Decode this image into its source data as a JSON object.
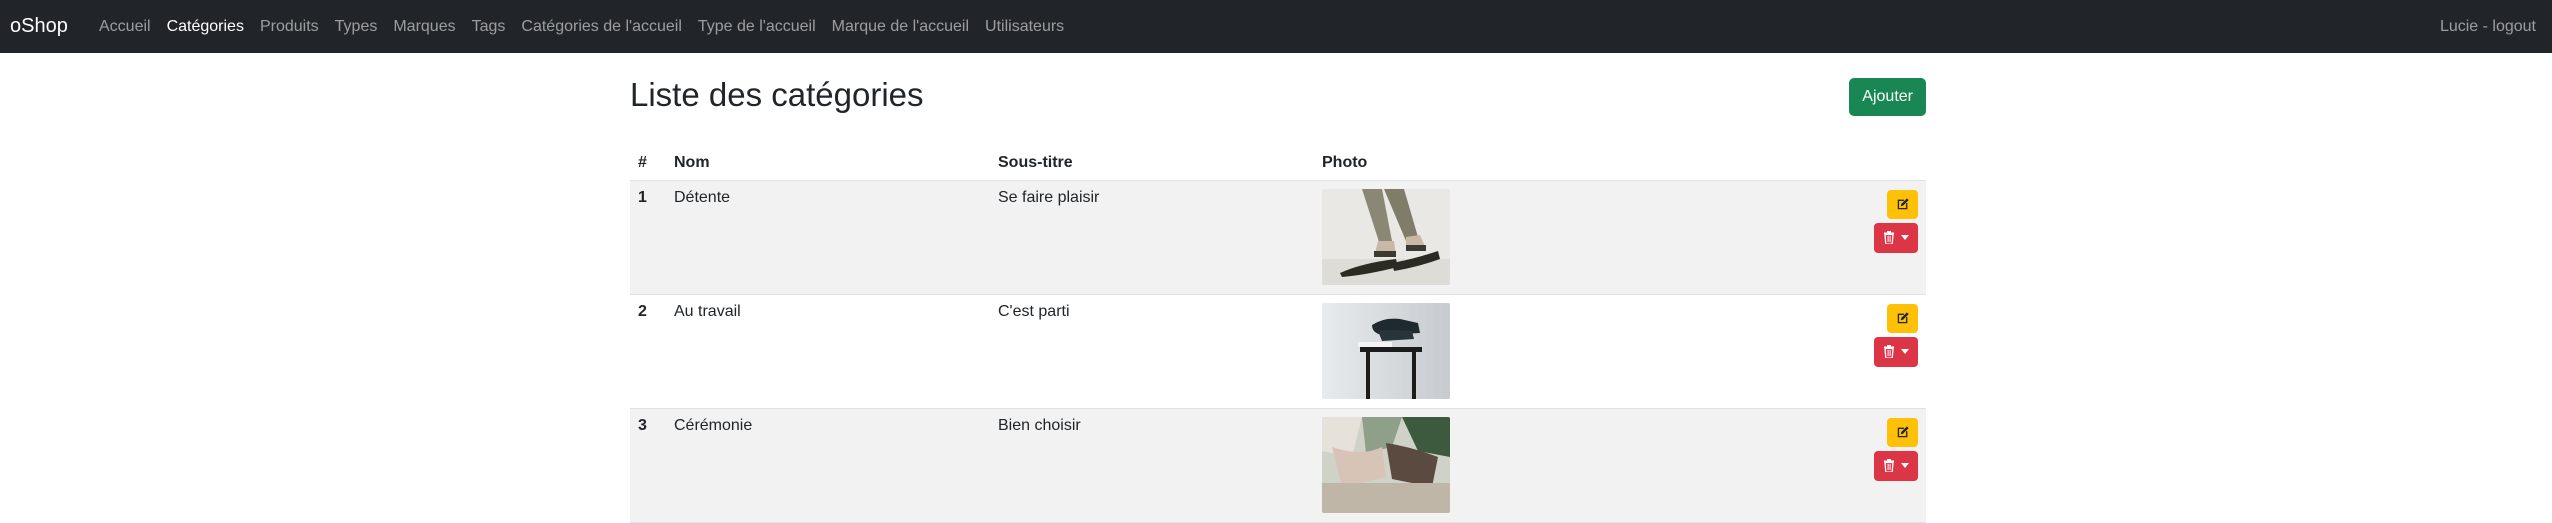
{
  "navbar": {
    "brand": "oShop",
    "links": [
      {
        "label": "Accueil",
        "active": false
      },
      {
        "label": "Catégories",
        "active": true
      },
      {
        "label": "Produits",
        "active": false
      },
      {
        "label": "Types",
        "active": false
      },
      {
        "label": "Marques",
        "active": false
      },
      {
        "label": "Tags",
        "active": false
      },
      {
        "label": "Catégories de l'accueil",
        "active": false
      },
      {
        "label": "Type de l'accueil",
        "active": false
      },
      {
        "label": "Marque de l'accueil",
        "active": false
      },
      {
        "label": "Utilisateurs",
        "active": false
      }
    ],
    "user": "Lucie - logout"
  },
  "page": {
    "title": "Liste des catégories",
    "add_button": "Ajouter"
  },
  "table": {
    "headers": [
      "#",
      "Nom",
      "Sous-titre",
      "Photo"
    ],
    "rows": [
      {
        "id": "1",
        "name": "Détente",
        "subtitle": "Se faire plaisir",
        "photo": "sandals-photo"
      },
      {
        "id": "2",
        "name": "Au travail",
        "subtitle": "C'est parti",
        "photo": "shoe-on-stool-photo"
      },
      {
        "id": "3",
        "name": "Cérémonie",
        "subtitle": "Bien choisir",
        "photo": "ceremony-photo"
      }
    ]
  },
  "icons": {
    "edit": "pencil-square-icon",
    "delete": "trash-icon",
    "dropdown": "caret-down-icon"
  },
  "colors": {
    "navbar_bg": "#212529",
    "add_button": "#198754",
    "edit_button": "#ffc107",
    "delete_button": "#dc3545",
    "stripe": "#f2f2f2"
  }
}
